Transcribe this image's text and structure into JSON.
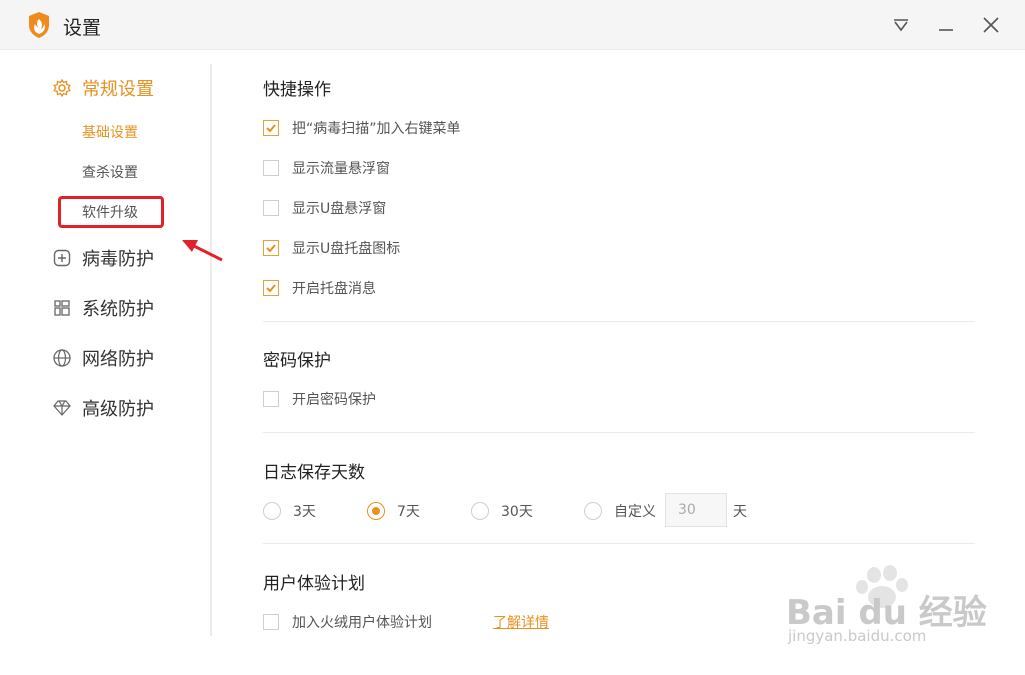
{
  "window": {
    "title": "设置"
  },
  "sidebar": {
    "general": {
      "label": "常规设置",
      "icon": "gear-icon",
      "sub_items": [
        {
          "label": "基础设置",
          "active": true
        },
        {
          "label": "查杀设置",
          "active": false
        },
        {
          "label": "软件升级",
          "active": false
        }
      ]
    },
    "items": [
      {
        "label": "病毒防护",
        "icon": "plus-box-icon"
      },
      {
        "label": "系统防护",
        "icon": "windows-icon"
      },
      {
        "label": "网络防护",
        "icon": "globe-icon"
      },
      {
        "label": "高级防护",
        "icon": "diamond-icon"
      }
    ]
  },
  "quick_ops": {
    "title": "快捷操作",
    "options": [
      {
        "label": "把“病毒扫描”加入右键菜单",
        "checked": true
      },
      {
        "label": "显示流量悬浮窗",
        "checked": false
      },
      {
        "label": "显示U盘悬浮窗",
        "checked": false
      },
      {
        "label": "显示U盘托盘图标",
        "checked": true
      },
      {
        "label": "开启托盘消息",
        "checked": true
      }
    ]
  },
  "password": {
    "title": "密码保护",
    "option": {
      "label": "开启密码保护",
      "checked": false
    }
  },
  "log_days": {
    "title": "日志保存天数",
    "options": [
      {
        "label": "3天",
        "checked": false
      },
      {
        "label": "7天",
        "checked": true
      },
      {
        "label": "30天",
        "checked": false
      },
      {
        "label": "自定义",
        "checked": false
      }
    ],
    "custom_value": "30",
    "unit": "天"
  },
  "ux_plan": {
    "title": "用户体验计划",
    "option": {
      "label": "加入火绒用户体验计划",
      "checked": false
    },
    "link": "了解详情"
  },
  "watermark": {
    "brand": "Bai du 经验",
    "domain": "jingyan.baidu.com"
  },
  "colors": {
    "accent": "#e8911f",
    "highlight": "#e2222a"
  }
}
